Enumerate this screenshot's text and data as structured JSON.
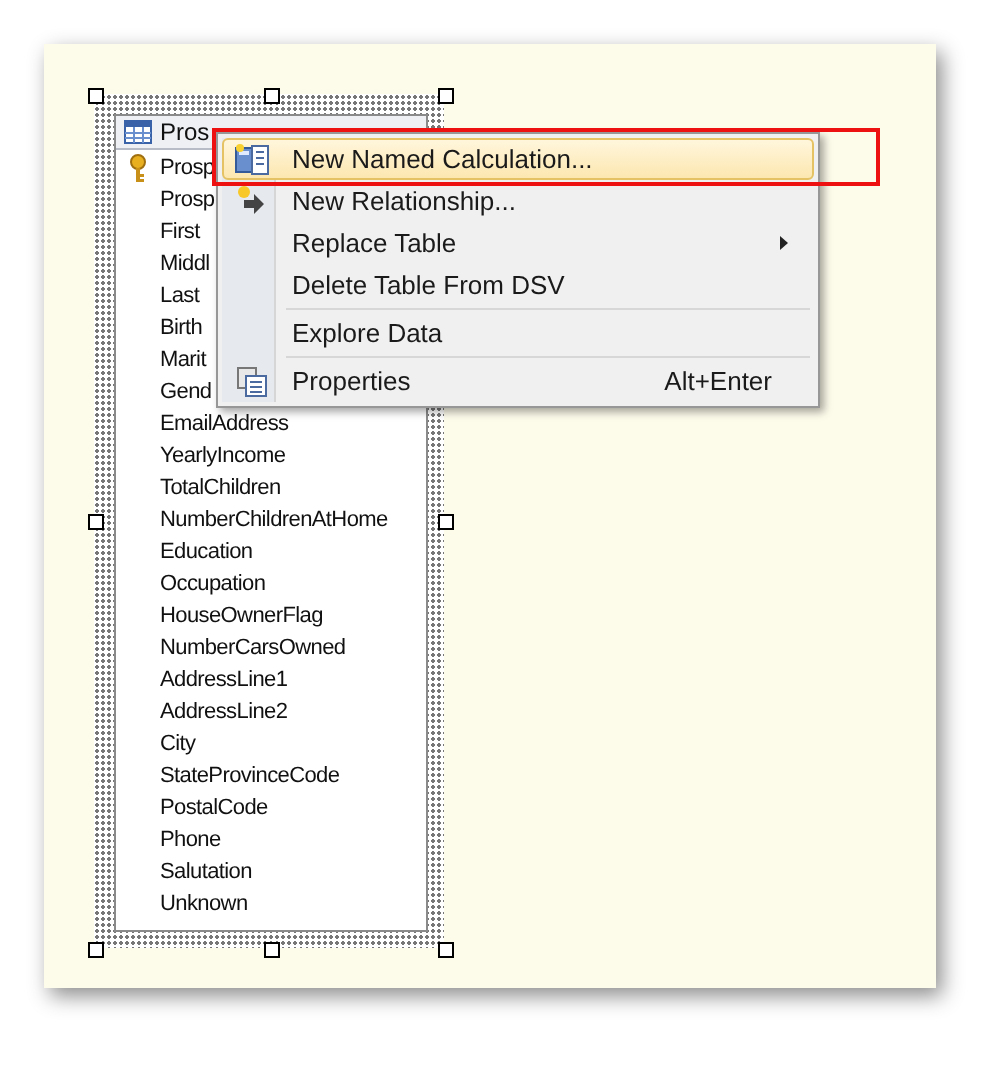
{
  "table": {
    "title": "Pros",
    "selected": true,
    "columns": [
      {
        "name": "Prosp",
        "key": true
      },
      {
        "name": "Prosp",
        "key": false
      },
      {
        "name": "First",
        "key": false
      },
      {
        "name": "Middl",
        "key": false
      },
      {
        "name": "Last",
        "key": false
      },
      {
        "name": "Birth",
        "key": false
      },
      {
        "name": "Marit",
        "key": false
      },
      {
        "name": "Gend",
        "key": false
      },
      {
        "name": "EmailAddress",
        "key": false
      },
      {
        "name": "YearlyIncome",
        "key": false
      },
      {
        "name": "TotalChildren",
        "key": false
      },
      {
        "name": "NumberChildrenAtHome",
        "key": false
      },
      {
        "name": "Education",
        "key": false
      },
      {
        "name": "Occupation",
        "key": false
      },
      {
        "name": "HouseOwnerFlag",
        "key": false
      },
      {
        "name": "NumberCarsOwned",
        "key": false
      },
      {
        "name": "AddressLine1",
        "key": false
      },
      {
        "name": "AddressLine2",
        "key": false
      },
      {
        "name": "City",
        "key": false
      },
      {
        "name": "StateProvinceCode",
        "key": false
      },
      {
        "name": "PostalCode",
        "key": false
      },
      {
        "name": "Phone",
        "key": false
      },
      {
        "name": "Salutation",
        "key": false
      },
      {
        "name": "Unknown",
        "key": false
      }
    ]
  },
  "context_menu": {
    "items": [
      {
        "kind": "item",
        "label": "New Named Calculation...",
        "selected": true,
        "submenu": false
      },
      {
        "kind": "item",
        "label": "New Relationship...",
        "selected": false,
        "submenu": false
      },
      {
        "kind": "item",
        "label": "Replace Table",
        "selected": false,
        "submenu": true
      },
      {
        "kind": "item",
        "label": "Delete Table From DSV",
        "selected": false,
        "submenu": false
      },
      {
        "kind": "separator"
      },
      {
        "kind": "item",
        "label": "Explore Data",
        "selected": false,
        "submenu": false
      },
      {
        "kind": "separator"
      },
      {
        "kind": "item",
        "label": "Properties",
        "selected": false,
        "submenu": false,
        "shortcut": "Alt+Enter"
      }
    ]
  }
}
